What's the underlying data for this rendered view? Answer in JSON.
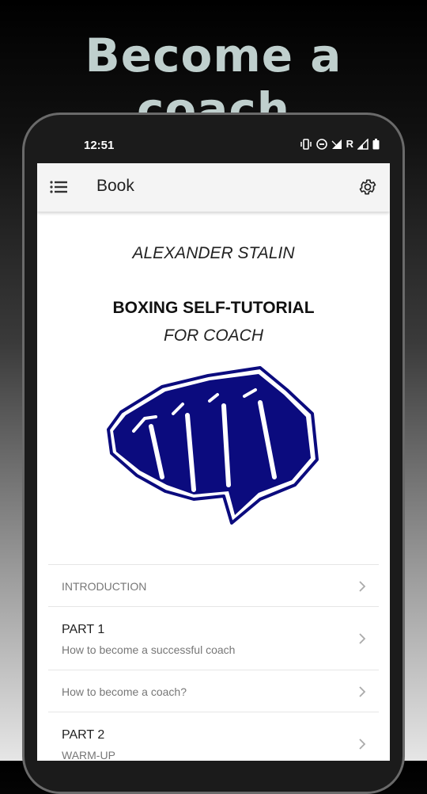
{
  "promo": {
    "title": "Become a coach"
  },
  "status_bar": {
    "time": "12:51",
    "icons": [
      "vibrate-icon",
      "dnd-icon",
      "signal-icon",
      "roaming-r",
      "signal-icon",
      "battery-icon"
    ],
    "roaming": "R"
  },
  "app_bar": {
    "title": "Book",
    "menu_icon": "menu-icon",
    "settings_icon": "gear-icon"
  },
  "book": {
    "author": "ALEXANDER STALIN",
    "title": "BOXING SELF-TUTORIAL",
    "subtitle": "FOR COACH",
    "cover_colors": {
      "fist": "#0b0b7e",
      "outline": "#0b0b7e"
    }
  },
  "toc": [
    {
      "primary": "",
      "secondary": "INTRODUCTION"
    },
    {
      "primary": "PART 1",
      "secondary": "How to become a successful coach"
    },
    {
      "primary": "",
      "secondary": "How to become a coach?"
    },
    {
      "primary": "PART 2",
      "secondary": "WARM-UP"
    }
  ]
}
